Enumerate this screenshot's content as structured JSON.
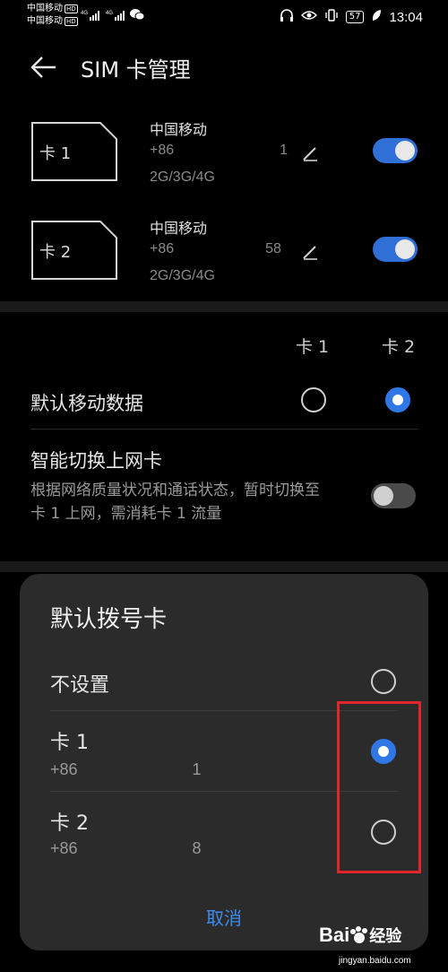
{
  "status_bar": {
    "carrier_1": "中国移动",
    "carrier_2": "中国移动",
    "hd": "HD",
    "net_1": "4G",
    "net_2": "4G",
    "battery": "57",
    "time": "13:04"
  },
  "header": {
    "title": "SIM 卡管理"
  },
  "sim_cards": [
    {
      "slot_label": "卡 1",
      "operator": "中国移动",
      "number": "+86",
      "number_tail": "1",
      "network": "2G/3G/4G",
      "enabled": true
    },
    {
      "slot_label": "卡 2",
      "operator": "中国移动",
      "number": "+86",
      "number_tail": "58",
      "network": "2G/3G/4G",
      "enabled": true
    }
  ],
  "data_settings": {
    "col_card1": "卡 1",
    "col_card2": "卡 2",
    "default_data_label": "默认移动数据",
    "default_data_selected": "卡 2",
    "smart_switch_label": "智能切换上网卡",
    "smart_switch_desc": "根据网络质量状况和通话状态，暂时切换至卡 1 上网，需消耗卡 1 流量",
    "smart_switch_enabled": false
  },
  "dialog": {
    "title": "默认拨号卡",
    "options": [
      {
        "label": "不设置",
        "sub": "",
        "selected": false
      },
      {
        "label": "卡 1",
        "sub": "+86",
        "sub_tail": "1",
        "selected": true
      },
      {
        "label": "卡 2",
        "sub": "+86",
        "sub_tail": "8",
        "selected": false
      }
    ],
    "cancel_label": "取消"
  },
  "watermark": {
    "brand": "Bai",
    "brand_suffix": "经验",
    "url": "jingyan.baidu.com"
  },
  "colors": {
    "accent": "#2f78e6",
    "highlight": "#e0262b",
    "background": "#000000",
    "dialog_bg": "#2b2b2b"
  }
}
